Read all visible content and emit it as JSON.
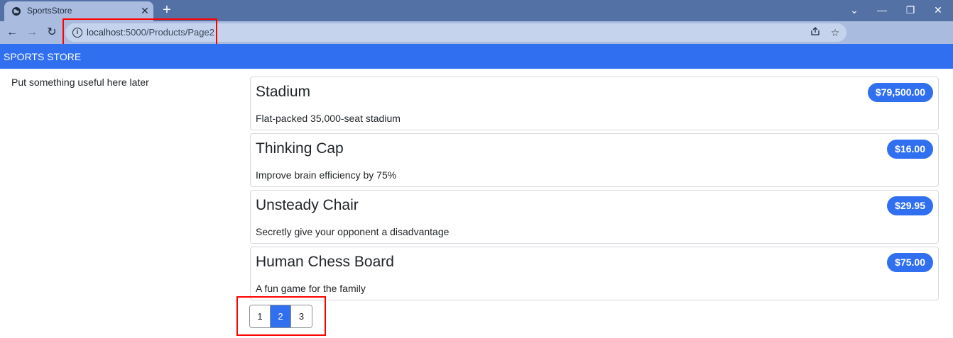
{
  "browser": {
    "tab_title": "SportsStore",
    "tab_close": "✕",
    "new_tab": "+",
    "url_host": "localhost",
    "url_path": ":5000/Products/Page2",
    "window_controls": {
      "chevron": "⌄",
      "minimize": "—",
      "restore": "❐",
      "close": "✕"
    },
    "nav": {
      "back": "←",
      "forward": "→",
      "reload": "↻"
    }
  },
  "navbar": {
    "brand": "SPORTS STORE",
    "color": "#2f6ff0"
  },
  "sidebar": {
    "note": "Put something useful here later"
  },
  "products": [
    {
      "name": "Stadium",
      "price": "$79,500.00",
      "description": "Flat-packed 35,000-seat stadium"
    },
    {
      "name": "Thinking Cap",
      "price": "$16.00",
      "description": "Improve brain efficiency by 75%"
    },
    {
      "name": "Unsteady Chair",
      "price": "$29.95",
      "description": "Secretly give your opponent a disadvantage"
    },
    {
      "name": "Human Chess Board",
      "price": "$75.00",
      "description": "A fun game for the family"
    }
  ],
  "pagination": {
    "pages": [
      "1",
      "2",
      "3"
    ],
    "current": "2"
  },
  "annotations": {
    "highlight_color": "#ff0000"
  }
}
